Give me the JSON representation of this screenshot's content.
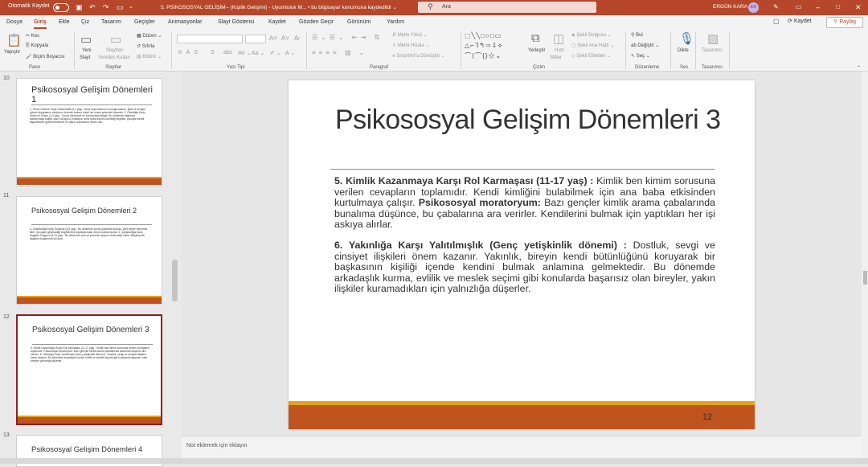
{
  "titlebar": {
    "autosave": "Otomatik Kaydet",
    "doc_title": "5. PSİKOSOSYAL GELİŞİM-- (Kişilik Gelişimi) - Uyumluluk M... • bu bilgisayar konumuna kaydedildi ⌄",
    "search": "Ara",
    "user": "ERGÜN KARA",
    "initials": "EK",
    "color": "#b7472a"
  },
  "menu": {
    "tabs": [
      "Dosya",
      "Giriş",
      "Ekle",
      "Çiz",
      "Tasarım",
      "Geçişler",
      "Animasyonlar",
      "Slayt Gösterisi",
      "Kaydet",
      "Gözden Geçir",
      "Görünüm",
      "Yardım"
    ],
    "save": "Kaydet",
    "share": "Paylaş"
  },
  "ribbon": {
    "paste": "Yapıştır",
    "cut": "Kes",
    "copy": "Kopyala",
    "format_painter": "Biçim Boyacısı",
    "new_slide_1": "Yeni",
    "new_slide_2": "Slayt",
    "reuse_1": "Slaytları",
    "reuse_2": "Yeniden Kullan",
    "layout": "Düzen",
    "reset": "Sıfırla",
    "section": "Bölüm",
    "text_direction": "Metin Yönü",
    "align_text": "Metni Hizala",
    "smartart": "SmartArt'a Dönüştür",
    "arrange": "Yerleştir",
    "quick_1": "Hızlı",
    "quick_2": "Stiller",
    "shape_fill": "Şekil Dolgusu",
    "shape_outline": "Şekil Ana Hattı",
    "shape_effects": "Şekil Efektleri",
    "find": "Bul",
    "replace": "Değiştir",
    "select": "Seç",
    "dictate": "Dikte",
    "designer": "Tasarımcı",
    "groups": {
      "clipboard": "Pano",
      "slides": "Slaytlar",
      "font": "Yazı Tipi",
      "paragraph": "Paragraf",
      "drawing": "Çizim",
      "editing": "Düzenleme",
      "voice": "Ses",
      "designer": "Tasarımcı"
    }
  },
  "thumbnails": [
    {
      "number": "10",
      "title": "Psikososyal Gelişim Dönemleri 1",
      "body": "1. Temel Güvene Karşı Güvensizlik (0-2 yaş) : Anne veya bakıcının çocuğa bakımı, ilgisi ve sevgisi güveni duygularını oluşturur. Annenin bakımı tutarlı ise çocuk güvende hisseder. 2. Özerkliğe Karşı Utanç ve Kuşku (2-3 yaş) : Çocuk yürümeye ve konuşmaya başlar. Bu dönemde bağımsız davranmaya başlar. Aşırı koruyucu, kısıtlayıcı anne baba tutumu özerkliği engeller, çocuğun kendi kapasitesine güvenmemesine ve utanç duymasına neden olur."
    },
    {
      "number": "11",
      "title": "Psikososyal Gelişim Dönemleri 2",
      "body": "3. Girişimciliğe Karşı Suçluluk (3-6 yaş) : Bu dönemde çocuk girişimde bulunur, yeni şeyler denemek ister. Çocuğun girişimciliği engellenirse yaptıklarından ötürü suçluluk duyar. 4. Çalışkanlığa Karşı Aşağılık Duygusu (6-11 yaş) : Bu dönemde okul ve çevrede başarılı olma isteği vardır. Başarısızlık aşağılık duygusuna yol açar."
    },
    {
      "number": "12",
      "title": "Psikososyal Gelişim Dönemleri 3",
      "body": "5. Kimlik Kazanmaya Karşı Rol Karmaşası (11-17 yaş) : Kimlik ben kimim sorusuna verilen cevapların toplamıdır. Psikososyal moratoryum: Bazı gençler kimlik arama çabalarında bunalıma düşünce ara verirler. 6. Yakınlığa Karşı Yalıtılmışlık (Genç yetişkinlik dönemi) : Dostluk, sevgi ve cinsiyet ilişkileri önem kazanır. Bu dönemde arkadaşlık kurma, evlilik ve meslek seçimi gibi konularda başarısız olan bireyler yalnızlığa düşerler."
    },
    {
      "number": "13",
      "title": "Psikososyal Gelişim Dönemleri 4",
      "body": ""
    }
  ],
  "slide": {
    "title": "Psikososyal Gelişim Dönemleri 3",
    "p1_head": "5. Kimlik Kazanmaya Karşı Rol Karmaşası (11-17 yaş) :",
    "p1_a": " Kimlik ben kimim sorusuna verilen cevapların toplamıdır. Kendi kimliğini bulabilmek için ana baba etkisinden kurtulmaya çalışır. ",
    "p1_bold": "Psikososyal moratoryum:",
    "p1_b": " Bazı gençler kimlik arama çabalarında bunalıma düşünce, bu çabalarına ara verirler. Kendilerini bulmak için yaptıkları her işi askıya alırlar.",
    "p2_head": "6. Yakınlığa Karşı Yalıtılmışlık (Genç yetişkinlik dönemi) :",
    "p2_a": " Dostluk, sevgi ve cinsiyet ilişkileri önem kazanır. Yakınlık, bireyin kendi bütünlüğünü koruyarak bir başkasının kişiliği içende kendini bulmak anlamına gelmektedir. Bu dönemde arkadaşlık kurma, evlilik ve meslek seçimi gibi konularda başarısız olan bireyler, yakın ilişkiler kuramadıkları için yalnızlığa düşerler.",
    "page_number": "12",
    "accent_color": "#c0541f",
    "stripe_color": "#e3a317"
  },
  "notes": {
    "placeholder": "Not eklemek için tıklayın"
  }
}
